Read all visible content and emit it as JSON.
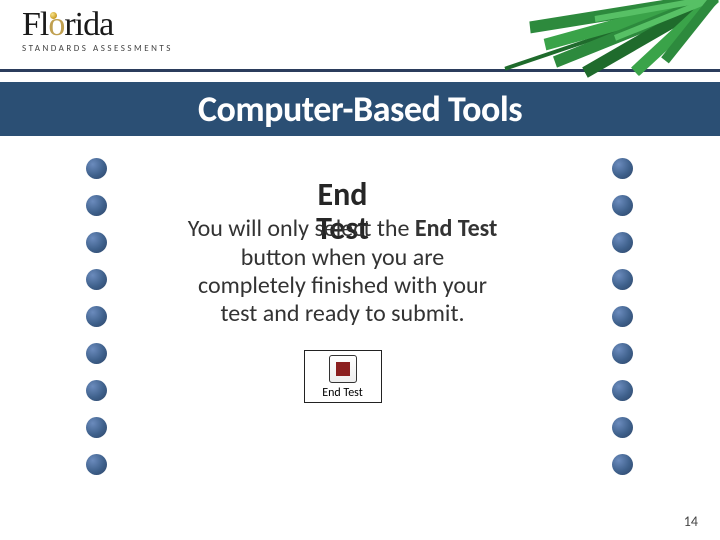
{
  "header": {
    "logo_main_pre": "Fl",
    "logo_main_accent": "o",
    "logo_main_post": "rida",
    "logo_sub": "Standards Assessments"
  },
  "title": "Computer-Based Tools",
  "content": {
    "heading_line1": "End",
    "heading_line2": "Test",
    "body_pre": "You will only select the ",
    "body_bold": "End Test",
    "body_post": " button when you are completely finished with your test and ready to submit."
  },
  "button": {
    "label": "End Test"
  },
  "page_number": "14"
}
